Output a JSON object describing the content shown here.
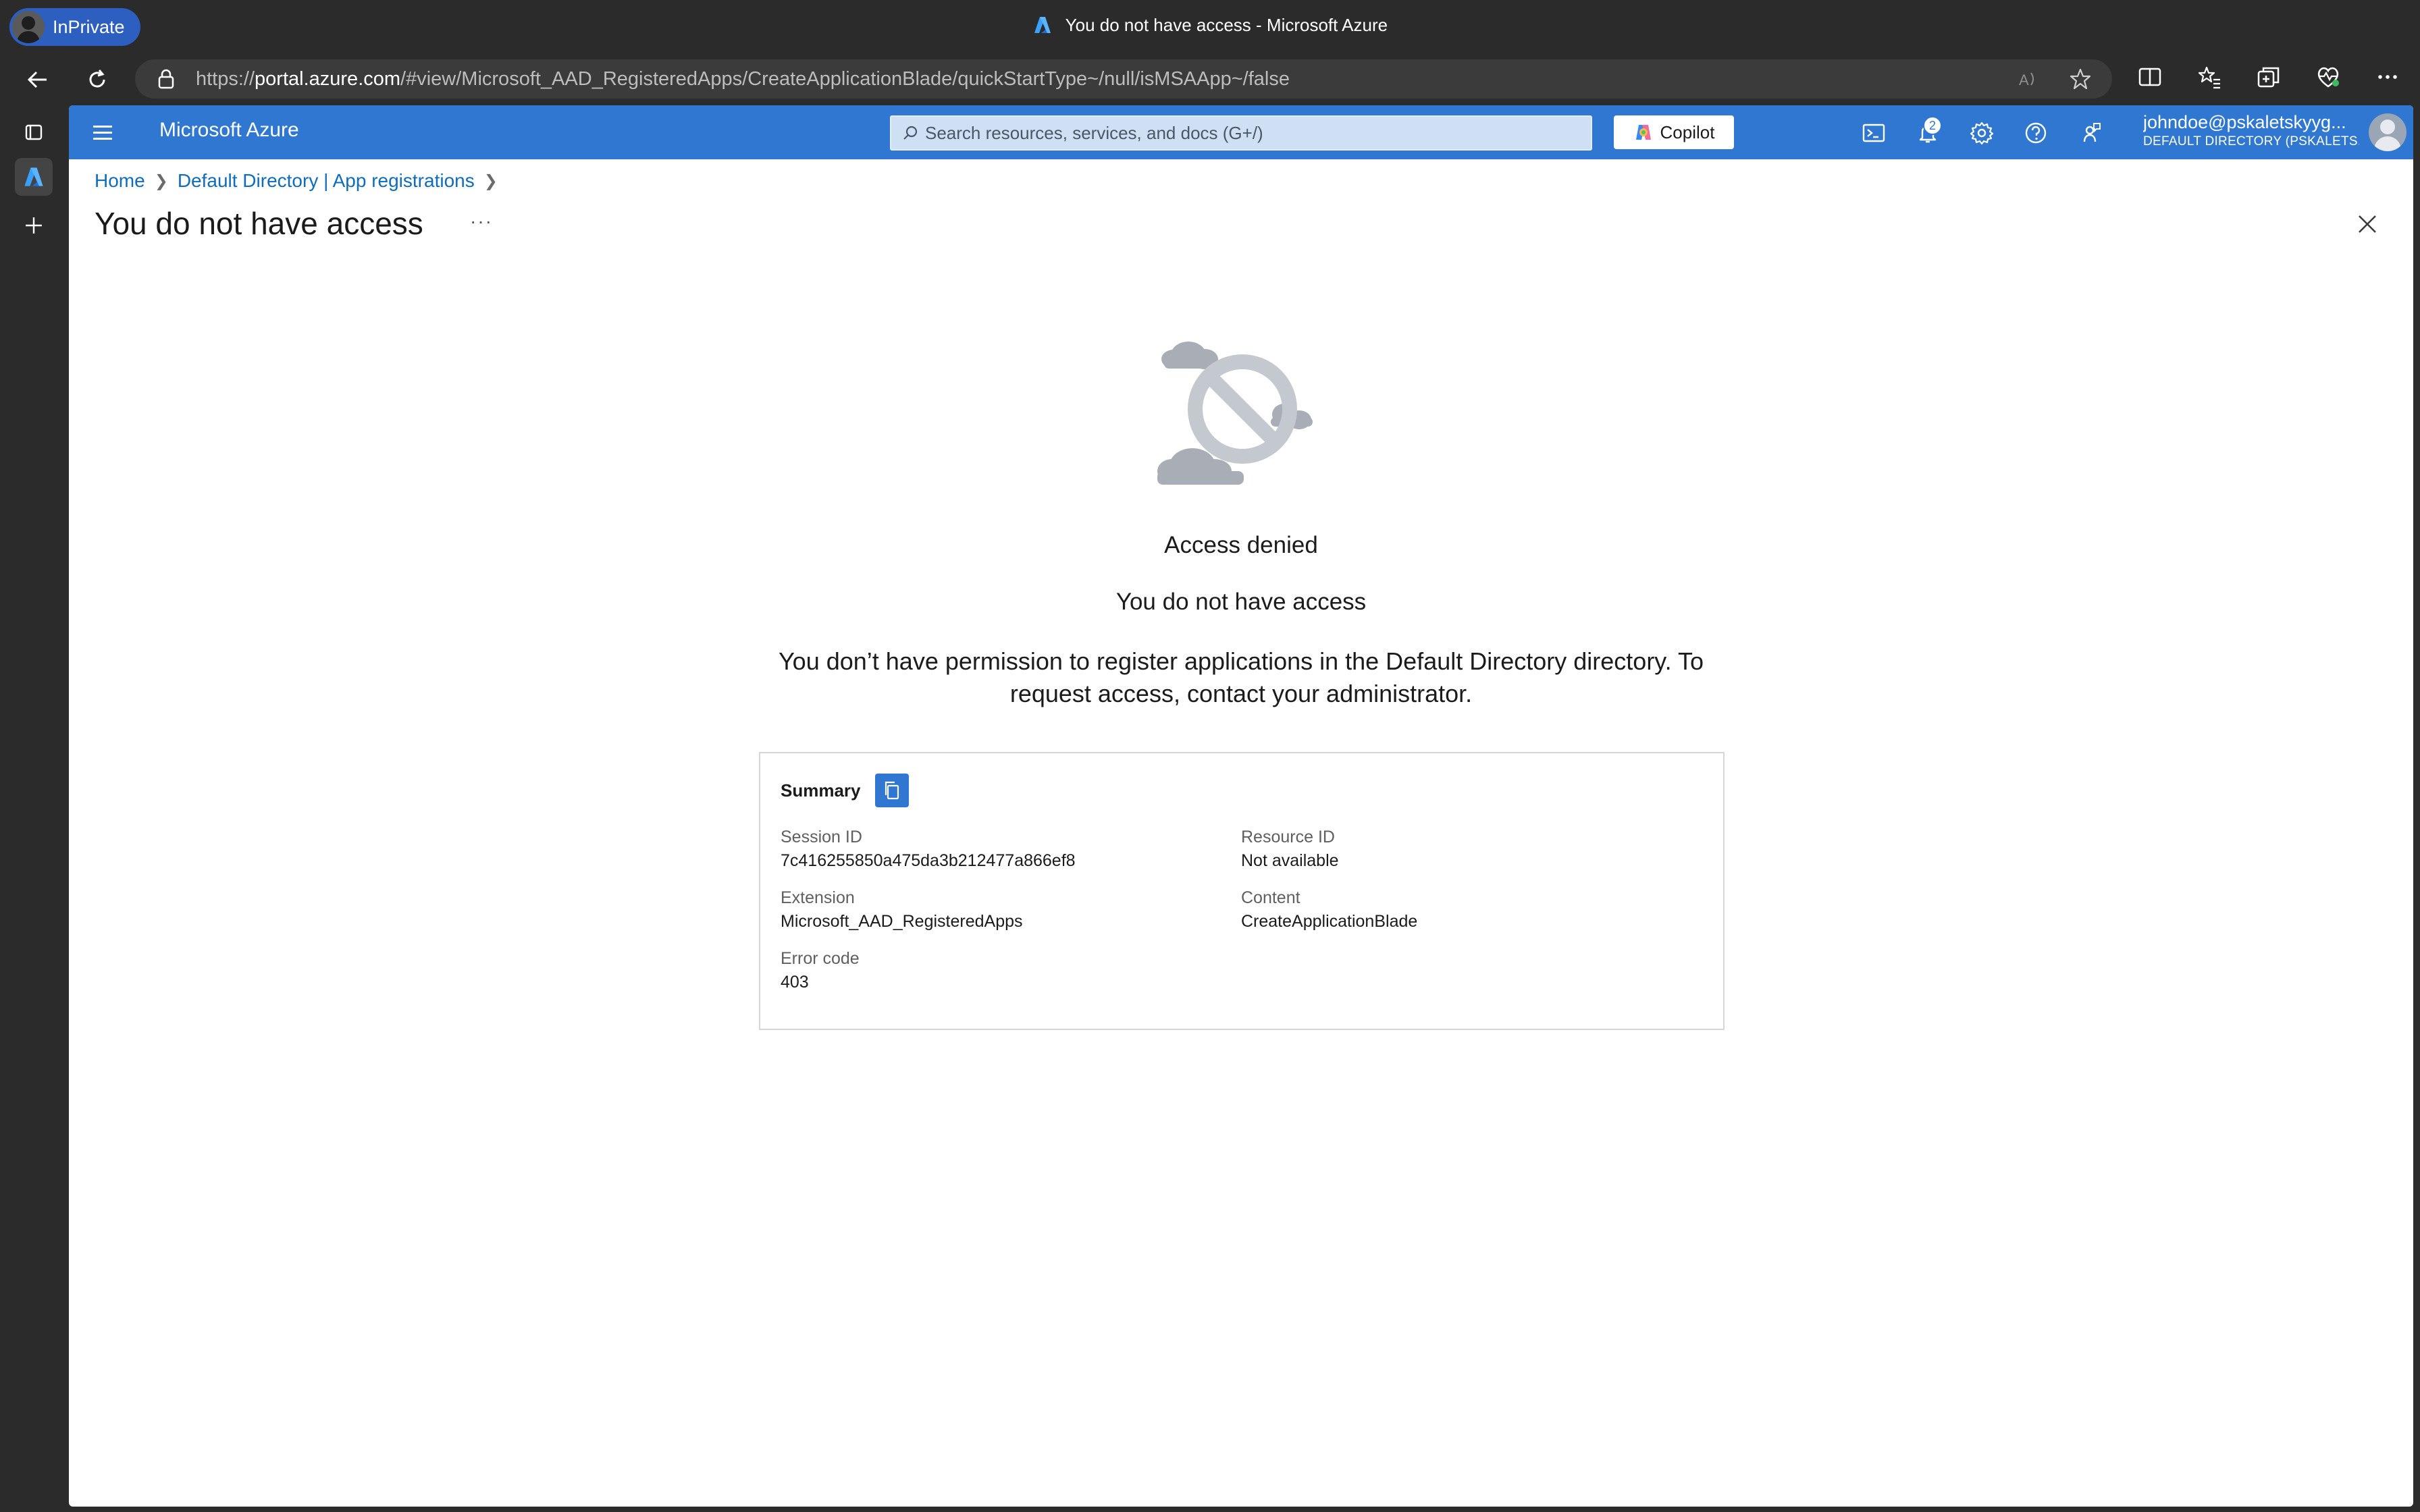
{
  "browser": {
    "inprivate_label": "InPrivate",
    "tab_title": "You do not have access - Microsoft Azure",
    "url_prefix": "https://",
    "url_host": "portal.azure.com",
    "url_path": "/#view/Microsoft_AAD_RegisteredApps/CreateApplicationBlade/quickStartType~/null/isMSAApp~/false"
  },
  "portal": {
    "brand": "Microsoft Azure",
    "search_placeholder": "Search resources, services, and docs (G+/)",
    "copilot_label": "Copilot",
    "notifications_count": "2",
    "user_email": "johndoe@pskaletskyyg...",
    "user_directory": "DEFAULT DIRECTORY (PSKALETS..."
  },
  "breadcrumb": {
    "home": "Home",
    "directory": "Default Directory | App registrations"
  },
  "page": {
    "title": "You do not have access",
    "more": "···",
    "heading_primary": "Access denied",
    "heading_secondary": "You do not have access",
    "message": "You don’t have permission to register applications in the Default Directory directory. To request access, contact your administrator."
  },
  "summary": {
    "title": "Summary",
    "session_id_label": "Session ID",
    "session_id": "7c416255850a475da3b212477a866ef8",
    "resource_id_label": "Resource ID",
    "resource_id": "Not available",
    "extension_label": "Extension",
    "extension": "Microsoft_AAD_RegisteredApps",
    "content_label": "Content",
    "content": "CreateApplicationBlade",
    "error_code_label": "Error code",
    "error_code": "403"
  },
  "colors": {
    "azure_blue": "#2f77d0",
    "link": "#0f6cbd",
    "browser_chrome": "#2b2b2b"
  }
}
